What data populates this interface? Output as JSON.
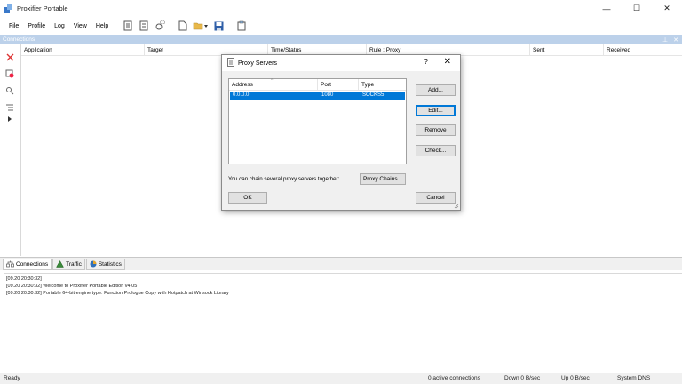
{
  "app": {
    "title": "Proxifier Portable",
    "controls": {
      "minimize": "—",
      "maximize": "☐",
      "close": "✕"
    }
  },
  "menu": [
    "File",
    "Profile",
    "Log",
    "View",
    "Help"
  ],
  "connections_panel": {
    "title": "Connections",
    "columns": [
      "Application",
      "Target",
      "Time/Status",
      "Rule : Proxy",
      "Sent",
      "Received"
    ]
  },
  "bottom_tabs": [
    "Connections",
    "Traffic",
    "Statistics"
  ],
  "log": [
    "[09.20 20:30:32]",
    "[09.20 20:30:32]    Welcome to Proxifier Portable Edition v4.05",
    "[09.20 20:30:32]    Portable 64-bit engine type: Function Prologue Copy with Hotpatch at Winsock Library"
  ],
  "status": {
    "left": "Ready",
    "connections": "0 active connections",
    "down": "Down 0 B/sec",
    "up": "Up 0 B/sec",
    "dns": "System DNS"
  },
  "dialog": {
    "title": "Proxy Servers",
    "help": "?",
    "close": "✕",
    "columns": [
      "Address",
      "Port",
      "Type"
    ],
    "rows": [
      {
        "address": "0.0.0.0",
        "port": "1080",
        "type": "SOCKS5"
      }
    ],
    "buttons": {
      "add": "Add...",
      "edit": "Edit...",
      "remove": "Remove",
      "check": "Check...",
      "proxy_chains": "Proxy Chains...",
      "ok": "OK",
      "cancel": "Cancel"
    },
    "chain_text": "You can chain several proxy servers together:"
  },
  "colors": {
    "header_blue": "#bcd1ea",
    "selection": "#0078d7"
  }
}
